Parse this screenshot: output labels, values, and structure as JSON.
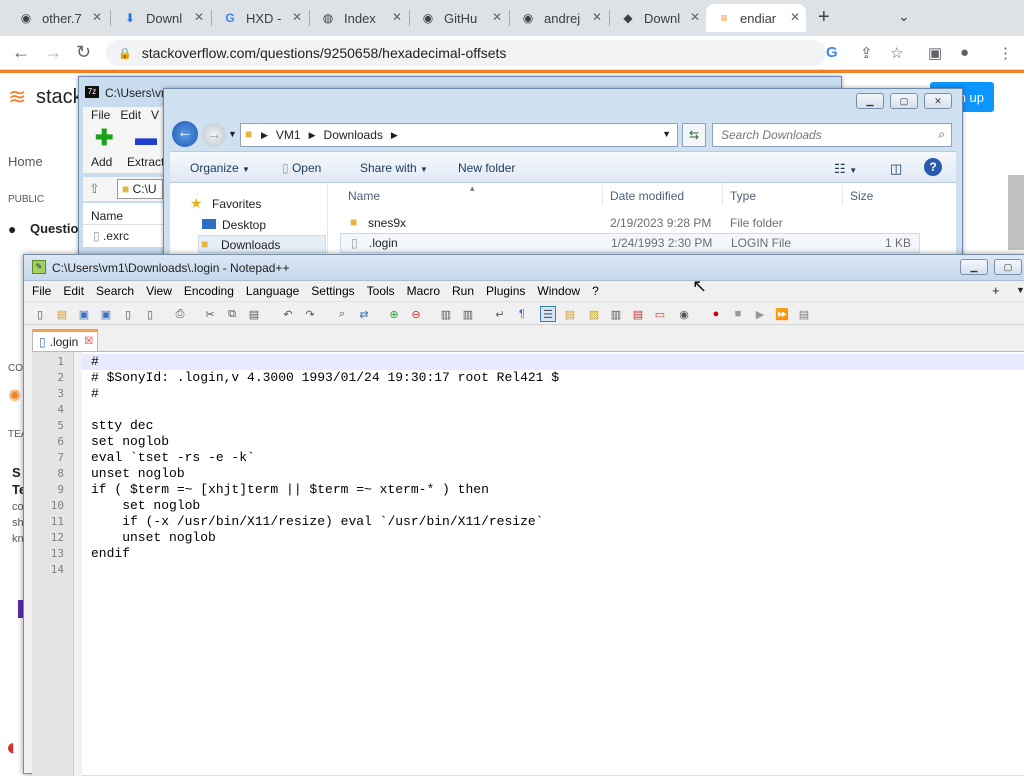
{
  "browser": {
    "tabs": [
      {
        "title": "other.7",
        "icon": "github-icon"
      },
      {
        "title": "Downl",
        "icon": "download-icon"
      },
      {
        "title": "HXD -",
        "icon": "google-icon"
      },
      {
        "title": "Index",
        "icon": "globe-icon"
      },
      {
        "title": "GitHu",
        "icon": "github-icon"
      },
      {
        "title": "andrej",
        "icon": "github-icon"
      },
      {
        "title": "Downl",
        "icon": "sony-icon"
      },
      {
        "title": "endiar",
        "icon": "stackoverflow-icon"
      }
    ],
    "url": "stackoverflow.com/questions/9250658/hexadecimal-offsets"
  },
  "stackoverflow": {
    "logo": "stack",
    "nav_home": "Home",
    "nav_public": "PUBLIC",
    "nav_questions": "Questio",
    "signup": "n up",
    "fragments": [
      "CO",
      "TEA",
      "S",
      "Te",
      "co",
      "sh",
      "kn"
    ]
  },
  "sevenzip": {
    "title": "C:\\Users\\vm",
    "menu": [
      "File",
      "Edit",
      "V"
    ],
    "add": "Add",
    "extract": "Extract",
    "path": "C:\\U",
    "col_name": "Name",
    "file": ".exrc"
  },
  "explorer": {
    "breadcrumb": [
      "VM1",
      "Downloads"
    ],
    "search_placeholder": "Search Downloads",
    "commands": {
      "organize": "Organize",
      "open": "Open",
      "share": "Share with",
      "new_folder": "New folder"
    },
    "nav": {
      "favorites": "Favorites",
      "desktop": "Desktop",
      "downloads": "Downloads"
    },
    "columns": {
      "name": "Name",
      "date": "Date modified",
      "type": "Type",
      "size": "Size"
    },
    "rows": [
      {
        "name": "snes9x",
        "date": "2/19/2023 9:28 PM",
        "type": "File folder",
        "size": ""
      },
      {
        "name": ".login",
        "date": "1/24/1993 2:30 PM",
        "type": "LOGIN File",
        "size": "1 KB"
      }
    ]
  },
  "notepad": {
    "title": "C:\\Users\\vm1\\Downloads\\.login - Notepad++",
    "menu": [
      "File",
      "Edit",
      "Search",
      "View",
      "Encoding",
      "Language",
      "Settings",
      "Tools",
      "Macro",
      "Run",
      "Plugins",
      "Window",
      "?"
    ],
    "plus": "+",
    "tab": ".login",
    "lines": [
      "#",
      "# $SonyId: .login,v 4.3000 1993/01/24 19:30:17 root Rel421 $",
      "#",
      "",
      "stty dec",
      "set noglob",
      "eval `tset -rs -e -k`",
      "unset noglob",
      "if ( $term =~ [xhjt]term || $term =~ xterm-* ) then",
      "    set noglob",
      "    if (-x /usr/bin/X11/resize) eval `/usr/bin/X11/resize`",
      "    unset noglob",
      "endif",
      ""
    ]
  }
}
